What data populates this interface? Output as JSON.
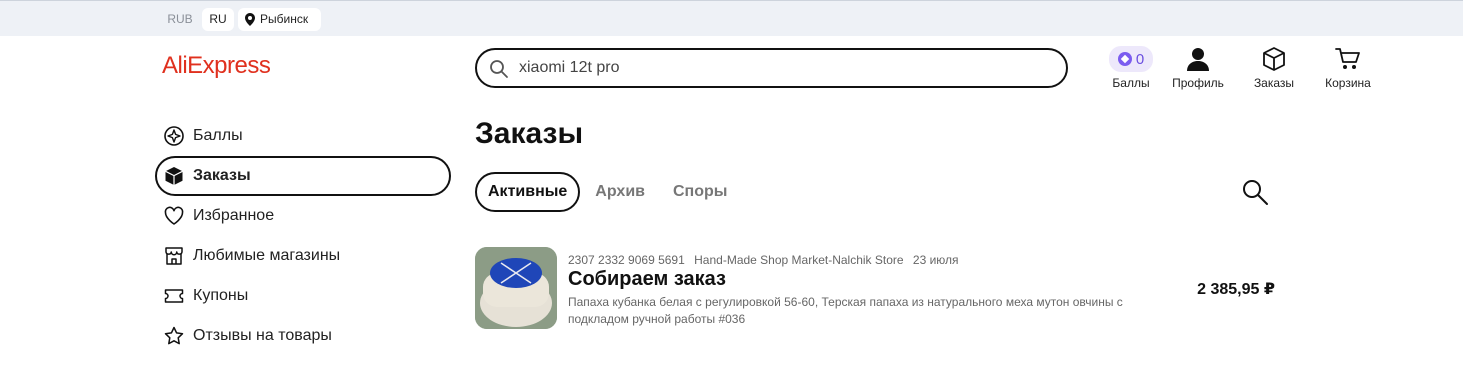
{
  "topbar": {
    "currency": "RUB",
    "language": "RU",
    "city": "Рыбинск"
  },
  "header": {
    "logo": "AliExpress",
    "search": {
      "value": "xiaomi 12t pro",
      "placeholder": ""
    },
    "points": {
      "count": "0",
      "label": "Баллы"
    },
    "profile_label": "Профиль",
    "orders_label": "Заказы",
    "cart_label": "Корзина"
  },
  "sidebar": {
    "items": [
      {
        "label": "Баллы",
        "icon": "points-icon"
      },
      {
        "label": "Заказы",
        "icon": "box-icon",
        "active": true
      },
      {
        "label": "Избранное",
        "icon": "heart-icon"
      },
      {
        "label": "Любимые магазины",
        "icon": "store-icon"
      },
      {
        "label": "Купоны",
        "icon": "coupon-icon"
      },
      {
        "label": "Отзывы на товары",
        "icon": "star-icon"
      }
    ]
  },
  "main": {
    "title": "Заказы",
    "tabs": [
      {
        "label": "Активные",
        "active": true
      },
      {
        "label": "Архив"
      },
      {
        "label": "Споры"
      }
    ],
    "orders": [
      {
        "number": "2307 2332 9069 5691",
        "store": "Hand-Made Shop Market-Nalchik Store",
        "date": "23 июля",
        "status": "Собираем заказ",
        "description": "Папаха кубанка белая с регулировкой 56-60, Терская папаха из натурального меха мутон овчины с подкладом ручной работы #036",
        "price": "2 385,95 ₽"
      }
    ]
  },
  "colors": {
    "brand": "#e0301e",
    "points_accent": "#7b5cf0",
    "text": "#111111",
    "muted": "#777777"
  }
}
